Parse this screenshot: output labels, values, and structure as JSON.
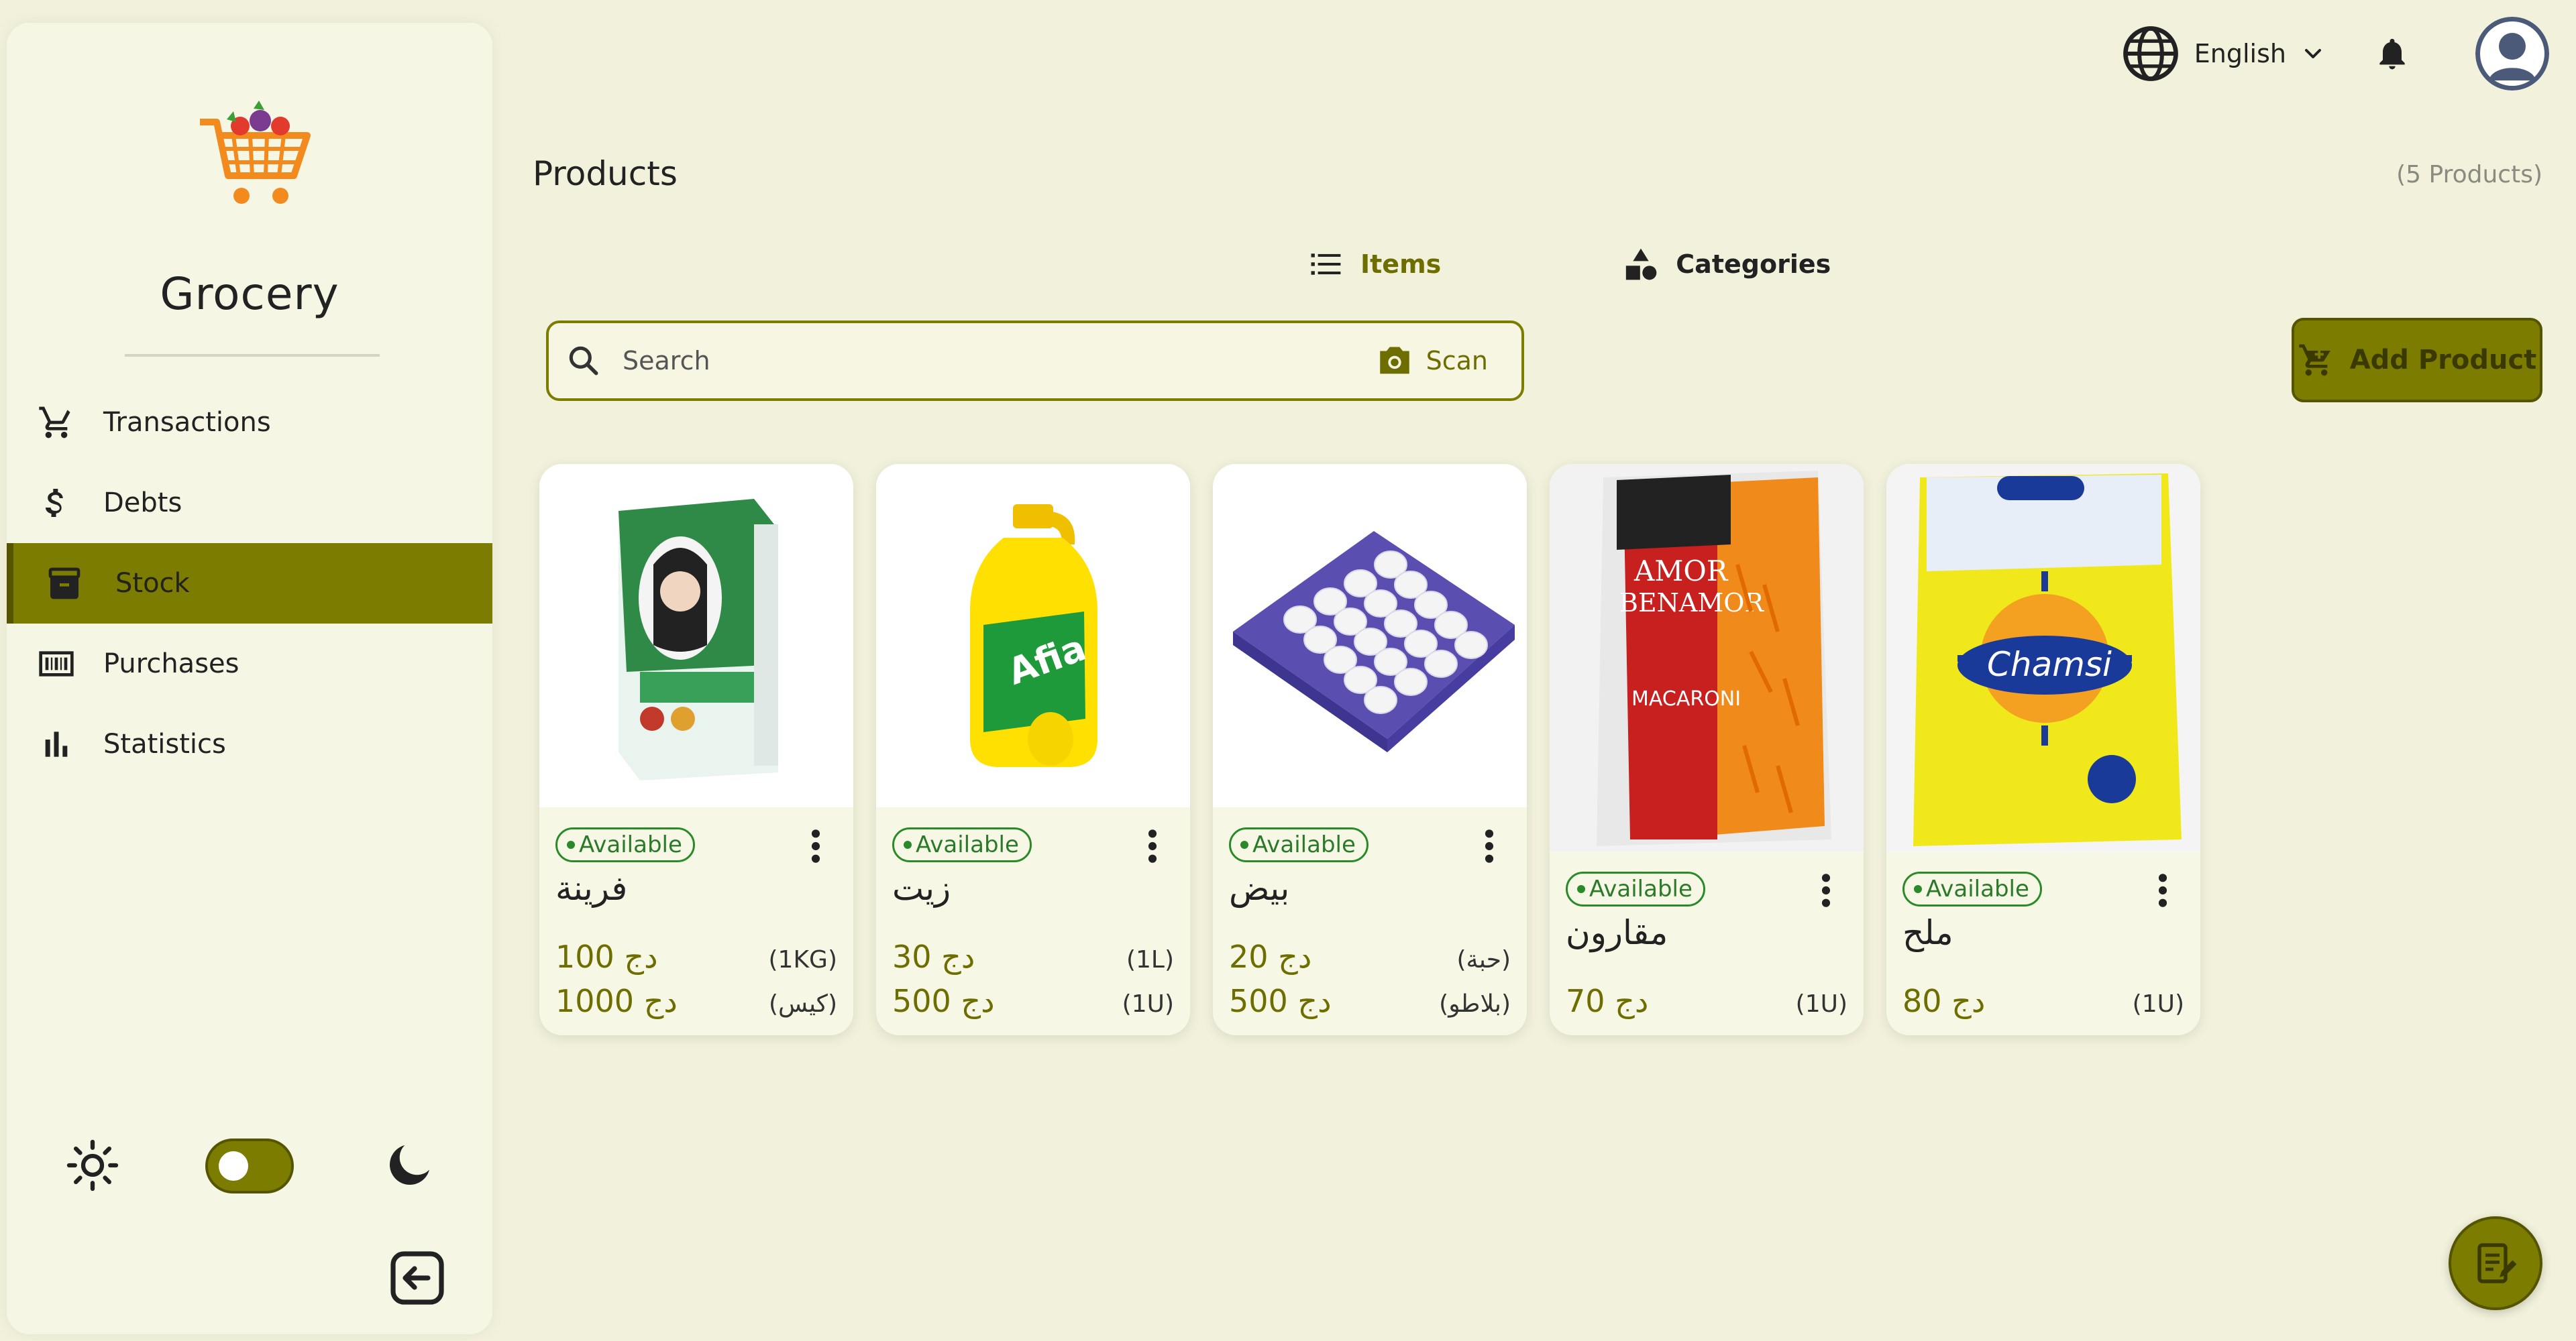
{
  "sidebar": {
    "brand": "Grocery",
    "items": [
      {
        "label": "Transactions",
        "icon": "cart-icon",
        "active": false
      },
      {
        "label": "Debts",
        "icon": "dollar-icon",
        "active": false
      },
      {
        "label": "Stock",
        "icon": "archive-icon",
        "active": true
      },
      {
        "label": "Purchases",
        "icon": "barcode-icon",
        "active": false
      },
      {
        "label": "Statistics",
        "icon": "bar-chart-icon",
        "active": false
      }
    ],
    "theme_toggle": {
      "dark_mode": true
    }
  },
  "topbar": {
    "language": "English"
  },
  "header": {
    "title": "Products",
    "count": "(5 Products)"
  },
  "tabs": [
    {
      "label": "Items",
      "active": true
    },
    {
      "label": "Categories",
      "active": false
    }
  ],
  "search": {
    "placeholder": "Search",
    "scan_label": "Scan"
  },
  "add_product_label": "Add Product",
  "products": [
    {
      "status": "Available",
      "name": "فرينة",
      "image": "flour-bag",
      "prices": [
        {
          "price": "100 دج",
          "unit": "(1KG)"
        },
        {
          "price": "1000 دج",
          "unit": "(كيس)"
        }
      ]
    },
    {
      "status": "Available",
      "name": "زيت",
      "image": "oil-bottle",
      "prices": [
        {
          "price": "30 دج",
          "unit": "(1L)"
        },
        {
          "price": "500 دج",
          "unit": "(1U)"
        }
      ]
    },
    {
      "status": "Available",
      "name": "بيض",
      "image": "egg-tray",
      "prices": [
        {
          "price": "20 دج",
          "unit": "(حبة)"
        },
        {
          "price": "500 دج",
          "unit": "(بلاطو)"
        }
      ]
    },
    {
      "status": "Available",
      "name": "مقارون",
      "image": "macaroni-pack",
      "prices": [
        {
          "price": "70 دج",
          "unit": "(1U)"
        }
      ]
    },
    {
      "status": "Available",
      "name": "ملح",
      "image": "salt-pack",
      "prices": [
        {
          "price": "80 دج",
          "unit": "(1U)"
        }
      ]
    }
  ],
  "colors": {
    "background": "#f2f2dc",
    "accent": "#7c7c00",
    "accent_dark": "#555500",
    "available": "#2a8a2a"
  }
}
